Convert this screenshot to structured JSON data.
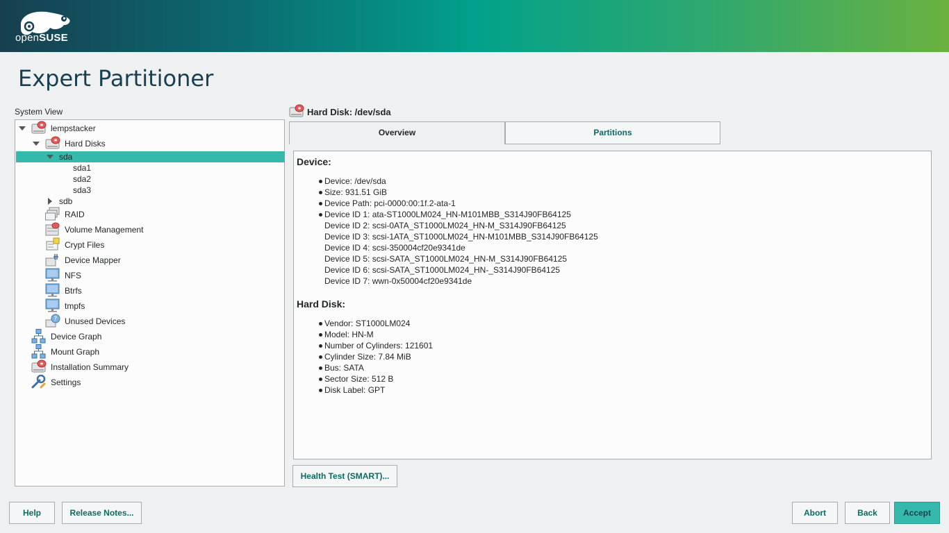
{
  "brand": {
    "logo_text_open": "open",
    "logo_text_suse": "SUSE"
  },
  "page": {
    "title": "Expert Partitioner"
  },
  "system_view": {
    "label": "System View",
    "tree": [
      {
        "label": "lempstacker",
        "icon": "hard-disk-icon"
      },
      {
        "label": "Hard Disks",
        "icon": "hard-disk-icon"
      },
      {
        "label": "sda",
        "selected": true
      },
      {
        "label": "sda1"
      },
      {
        "label": "sda2"
      },
      {
        "label": "sda3"
      },
      {
        "label": "sdb"
      },
      {
        "label": "RAID",
        "icon": "raid-icon"
      },
      {
        "label": "Volume Management",
        "icon": "volume-management-icon"
      },
      {
        "label": "Crypt Files",
        "icon": "crypt-files-icon"
      },
      {
        "label": "Device Mapper",
        "icon": "device-mapper-icon"
      },
      {
        "label": "NFS",
        "icon": "nfs-icon"
      },
      {
        "label": "Btrfs",
        "icon": "btrfs-icon"
      },
      {
        "label": "tmpfs",
        "icon": "tmpfs-icon"
      },
      {
        "label": "Unused Devices",
        "icon": "unused-devices-icon"
      },
      {
        "label": "Device Graph",
        "icon": "device-graph-icon"
      },
      {
        "label": "Mount Graph",
        "icon": "mount-graph-icon"
      },
      {
        "label": "Installation Summary",
        "icon": "installation-summary-icon"
      },
      {
        "label": "Settings",
        "icon": "settings-icon"
      }
    ]
  },
  "detail": {
    "header": "Hard Disk: /dev/sda",
    "tabs": [
      {
        "label": "Overview",
        "active": true
      },
      {
        "label": "Partitions",
        "active": false
      }
    ],
    "device_section": {
      "title": "Device:",
      "items": [
        {
          "text": "Device: /dev/sda",
          "bullet": true
        },
        {
          "text": "Size: 931.51 GiB",
          "bullet": true
        },
        {
          "text": "Device Path: pci-0000:00:1f.2-ata-1",
          "bullet": true
        },
        {
          "text": "Device ID 1: ata-ST1000LM024_HN-M101MBB_S314J90FB64125",
          "bullet": true
        },
        {
          "text": "Device ID 2: scsi-0ATA_ST1000LM024_HN-M_S314J90FB64125",
          "bullet": false
        },
        {
          "text": "Device ID 3: scsi-1ATA_ST1000LM024_HN-M101MBB_S314J90FB64125",
          "bullet": false
        },
        {
          "text": "Device ID 4: scsi-350004cf20e9341de",
          "bullet": false
        },
        {
          "text": "Device ID 5: scsi-SATA_ST1000LM024_HN-M_S314J90FB64125",
          "bullet": false
        },
        {
          "text": "Device ID 6: scsi-SATA_ST1000LM024_HN-_S314J90FB64125",
          "bullet": false
        },
        {
          "text": "Device ID 7: wwn-0x50004cf20e9341de",
          "bullet": false
        }
      ]
    },
    "hard_disk_section": {
      "title": "Hard Disk:",
      "items": [
        {
          "text": "Vendor: ST1000LM024",
          "bullet": true
        },
        {
          "text": "Model: HN-M",
          "bullet": true
        },
        {
          "text": "Number of Cylinders: 121601",
          "bullet": true
        },
        {
          "text": "Cylinder Size: 7.84 MiB",
          "bullet": true
        },
        {
          "text": "Bus: SATA",
          "bullet": true
        },
        {
          "text": "Sector Size: 512 B",
          "bullet": true
        },
        {
          "text": "Disk Label: GPT",
          "bullet": true
        }
      ]
    },
    "health_test_label": "Health Test (SMART)..."
  },
  "footer": {
    "help": "Help",
    "release_notes": "Release Notes...",
    "abort": "Abort",
    "back": "Back",
    "accept": "Accept"
  },
  "colors": {
    "selection": "#35b9ab",
    "accent_text": "#0a6b63",
    "title": "#173f4f"
  }
}
